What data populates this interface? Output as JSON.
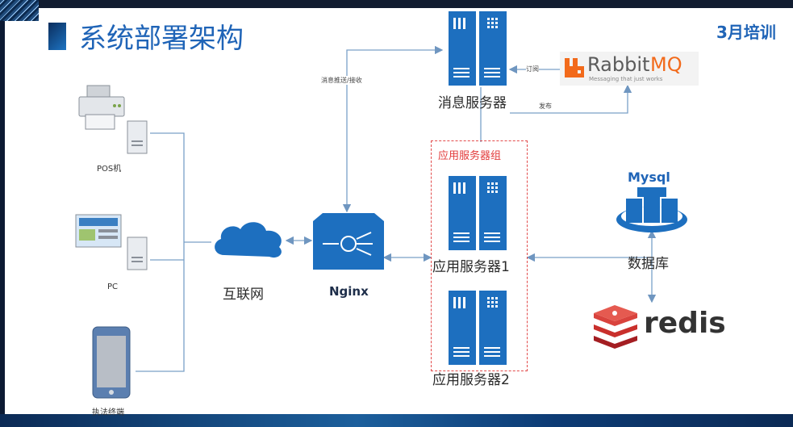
{
  "title": "系统部署架构",
  "badge": "3月培训",
  "clients": {
    "pos": "POS机",
    "pc": "PC",
    "mobile": "执法终端"
  },
  "network": {
    "internet": "互联网",
    "nginx": "Nginx"
  },
  "servers": {
    "message": "消息服务器",
    "group_label": "应用服务器组",
    "app1": "应用服务器1",
    "app2": "应用服务器2"
  },
  "edges": {
    "push_receive": "消息推送/接收",
    "subscribe": "订阅",
    "publish": "发布"
  },
  "data_stores": {
    "mysql": "Mysql",
    "database": "数据库",
    "redis": "redis"
  },
  "rabbitmq": {
    "name_rabbit": "Rabbit",
    "name_mq": "MQ",
    "tagline": "Messaging that just works"
  },
  "colors": {
    "title_blue": "#1f64b7",
    "server_blue": "#1d6fbf",
    "line": "#7aa0c8",
    "group_border": "#e24b4b",
    "rabbit_orange": "#f26a1b",
    "redis_red": "#c9302c"
  }
}
